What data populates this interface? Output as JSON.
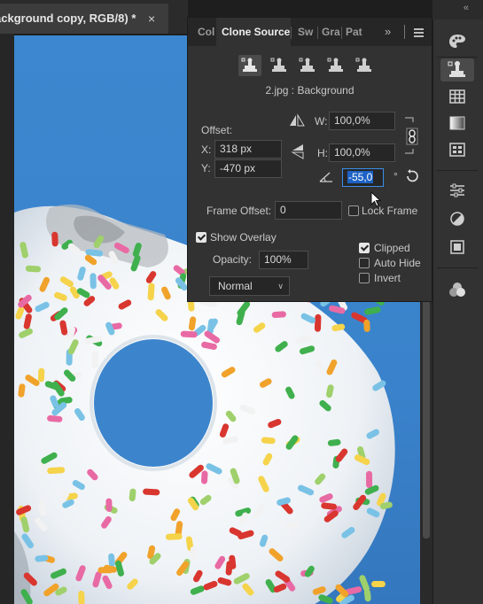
{
  "document": {
    "tab_title": "ackground copy, RGB/8) *",
    "close_glyph": "×"
  },
  "panel_group": {
    "tabs": [
      {
        "label": "Col",
        "active": false
      },
      {
        "label": "Clone Source",
        "active": true
      },
      {
        "label": "Sw",
        "active": false
      },
      {
        "label": "Gra",
        "active": false
      },
      {
        "label": "Pat",
        "active": false
      }
    ],
    "more_glyph": "»",
    "collapse_glyph": "«"
  },
  "clone_source": {
    "source_file": "2.jpg : Background",
    "offset_label": "Offset:",
    "x_label": "X:",
    "x_value": "318 px",
    "y_label": "Y:",
    "y_value": "-470 px",
    "w_label": "W:",
    "w_value": "100,0%",
    "h_label": "H:",
    "h_value": "100,0%",
    "angle_value": "-55,0",
    "degree_symbol": "°",
    "frame_offset_label": "Frame Offset:",
    "frame_offset_value": "0",
    "lock_frame_label": "Lock Frame",
    "lock_frame_checked": false,
    "show_overlay_label": "Show Overlay",
    "show_overlay_checked": true,
    "opacity_label": "Opacity:",
    "opacity_value": "100%",
    "blend_mode": "Normal",
    "clipped_label": "Clipped",
    "clipped_checked": true,
    "auto_hide_label": "Auto Hide",
    "auto_hide_checked": false,
    "invert_label": "Invert",
    "invert_checked": false
  },
  "right_bar_icons": [
    "palette-icon",
    "clone-stamp-icon",
    "grid-icon",
    "gradient-icon",
    "pattern-icon",
    "adjustments-icon",
    "circle-half-icon",
    "libraries-icon",
    "channels-icon"
  ],
  "colors": {
    "panel_bg": "#323232",
    "accent_blue": "#1d62c4",
    "canvas_sky": "#3a83cc"
  }
}
